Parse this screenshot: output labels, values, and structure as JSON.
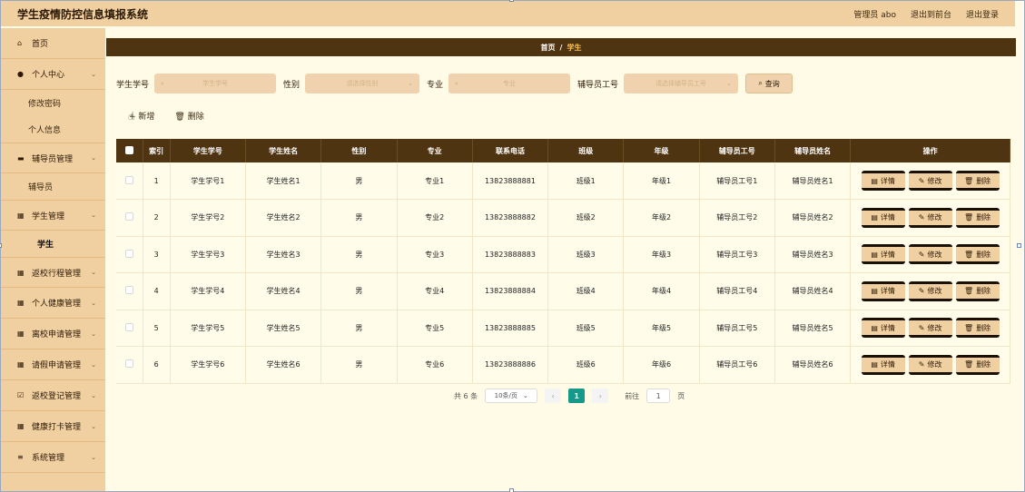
{
  "header": {
    "app_title": "学生疫情防控信息填报系统",
    "admin_label": "管理员 abo",
    "back_to_front": "退出到前台",
    "logout": "退出登录"
  },
  "sidebar": {
    "items": [
      {
        "label": "首页",
        "icon": "home-icon"
      },
      {
        "label": "个人中心",
        "icon": "user-icon",
        "children": [
          "修改密码",
          "个人信息"
        ]
      },
      {
        "label": "辅导员管理",
        "icon": "briefcase-icon",
        "children": [
          "辅导员"
        ]
      },
      {
        "label": "学生管理",
        "icon": "grid-icon",
        "children": [
          "学生"
        ]
      },
      {
        "label": "返校行程管理",
        "icon": "grid-icon"
      },
      {
        "label": "个人健康管理",
        "icon": "grid-icon"
      },
      {
        "label": "离校申请管理",
        "icon": "grid-icon"
      },
      {
        "label": "请假申请管理",
        "icon": "grid-icon"
      },
      {
        "label": "返校登记管理",
        "icon": "checkbox-icon"
      },
      {
        "label": "健康打卡管理",
        "icon": "grid-icon"
      },
      {
        "label": "系统管理",
        "icon": "menu-icon"
      }
    ]
  },
  "breadcrumb": {
    "home": "首页",
    "separator": "/",
    "current": "学生"
  },
  "search": {
    "student_no_label": "学生学号",
    "student_no_placeholder": "学生学号",
    "gender_label": "性别",
    "gender_placeholder": "请选择性别",
    "major_label": "专业",
    "major_placeholder": "专业",
    "counselor_no_label": "辅导员工号",
    "counselor_no_placeholder": "请选择辅导员工号",
    "query_button": "查询"
  },
  "actions": {
    "add": "新增",
    "delete": "删除"
  },
  "table": {
    "headers": [
      "",
      "索引",
      "学生学号",
      "学生姓名",
      "性别",
      "专业",
      "联系电话",
      "班级",
      "年级",
      "辅导员工号",
      "辅导员姓名",
      "操作"
    ],
    "rows": [
      [
        "1",
        "学生学号1",
        "学生姓名1",
        "男",
        "专业1",
        "13823888881",
        "班级1",
        "年级1",
        "辅导员工号1",
        "辅导员姓名1"
      ],
      [
        "2",
        "学生学号2",
        "学生姓名2",
        "男",
        "专业2",
        "13823888882",
        "班级2",
        "年级2",
        "辅导员工号2",
        "辅导员姓名2"
      ],
      [
        "3",
        "学生学号3",
        "学生姓名3",
        "男",
        "专业3",
        "13823888883",
        "班级3",
        "年级3",
        "辅导员工号3",
        "辅导员姓名3"
      ],
      [
        "4",
        "学生学号4",
        "学生姓名4",
        "男",
        "专业4",
        "13823888884",
        "班级4",
        "年级4",
        "辅导员工号4",
        "辅导员姓名4"
      ],
      [
        "5",
        "学生学号5",
        "学生姓名5",
        "男",
        "专业5",
        "13823888885",
        "班级5",
        "年级5",
        "辅导员工号5",
        "辅导员姓名5"
      ],
      [
        "6",
        "学生学号6",
        "学生姓名6",
        "男",
        "专业6",
        "13823888886",
        "班级6",
        "年级6",
        "辅导员工号6",
        "辅导员姓名6"
      ]
    ],
    "row_actions": {
      "detail": "详情",
      "edit": "修改",
      "delete": "删除"
    }
  },
  "pagination": {
    "total": "共 6 条",
    "page_size": "10条/页",
    "current_page": "1",
    "goto_label": "前往",
    "goto_value": "1",
    "page_suffix": "页"
  },
  "colors": {
    "header_bg": "#f0cfa1",
    "accent_dark": "#4f3412",
    "content_bg": "#fffbe6",
    "page_active": "#159a8a"
  }
}
